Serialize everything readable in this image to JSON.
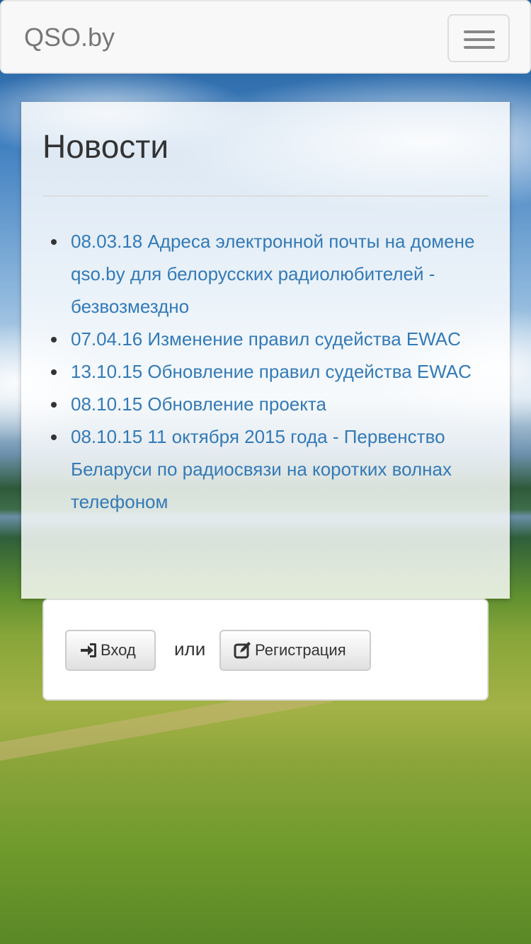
{
  "navbar": {
    "brand": "QSO.by",
    "toggle_icon": "hamburger-menu-icon"
  },
  "news": {
    "title": "Новости",
    "items": [
      "08.03.18 Адреса электронной почты на домене qso.by для белорусских радиолюбителей - безвозмездно",
      "07.04.16 Изменение правил судейства EWAC",
      "13.10.15 Обновление правил судейства EWAC",
      "08.10.15 Обновление проекта",
      "08.10.15 11 октября 2015 года - Первенство Беларуси по радиосвязи на коротких волнах телефоном"
    ]
  },
  "auth": {
    "login_label": "Вход",
    "login_icon": "sign-in-icon",
    "or_label": "или",
    "register_label": "Регистрация",
    "register_icon": "edit-icon"
  },
  "colors": {
    "link": "#337ab7",
    "navbar_bg": "#f8f8f8"
  }
}
